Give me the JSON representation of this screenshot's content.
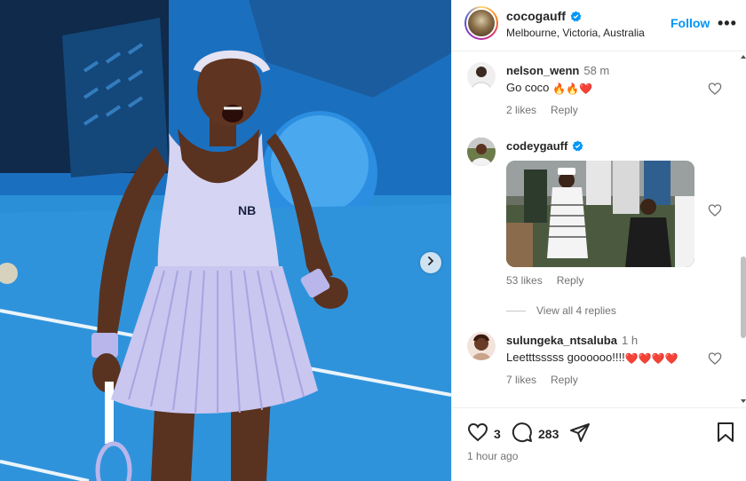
{
  "post": {
    "username": "cocogauff",
    "location": "Melbourne, Victoria, Australia",
    "follow_label": "Follow",
    "more_label": "•••"
  },
  "comments": [
    {
      "username": "nelson_wenn",
      "time": "58 m",
      "text": "Go coco",
      "emojis": [
        "🔥",
        "🔥",
        "❤️"
      ],
      "likes": "2 likes",
      "reply": "Reply"
    },
    {
      "username": "codeygauff",
      "verified": true,
      "likes": "53 likes",
      "reply": "Reply",
      "view_replies": "View all 4 replies"
    },
    {
      "username": "sulungeka_ntsaluba",
      "time": "1 h",
      "text": "Leetttsssss goooooo!!!!",
      "emojis": [
        "❤️",
        "❤️",
        "❤️",
        "❤️"
      ],
      "likes": "7 likes",
      "reply": "Reply"
    }
  ],
  "actions": {
    "like_count": "3",
    "comment_count": "283",
    "posted": "1 hour ago"
  },
  "colors": {
    "accent": "#0095f6",
    "verified": "#0095f6",
    "court": "#1f86d1",
    "heart": "#e0162b"
  },
  "icons": [
    "chevron-right-icon",
    "verified-icon",
    "heart-icon",
    "comment-icon",
    "share-icon",
    "bookmark-icon"
  ]
}
